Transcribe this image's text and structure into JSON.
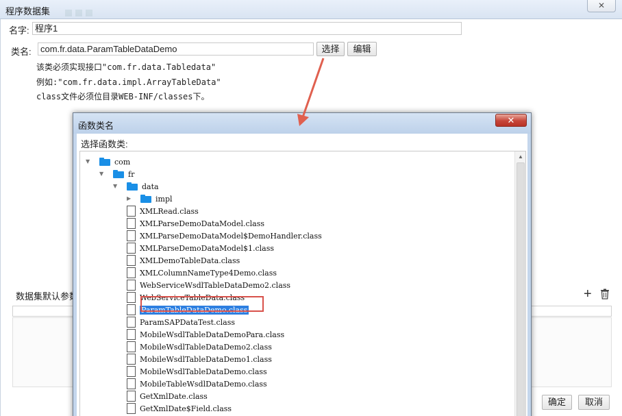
{
  "outer_dialog": {
    "title": "程序数据集",
    "close_glyph": "✕",
    "name_label": "名字:",
    "name_value": "程序1",
    "class_label": "类名:",
    "class_value": "com.fr.data.ParamTableDataDemo",
    "select_button": "选择",
    "edit_button": "编辑",
    "notes": [
      "该类必须实现接口\"com.fr.data.Tabledata\"",
      "例如:\"com.fr.data.impl.ArrayTableData\"",
      "class文件必须位目录WEB-INF/classes下。"
    ],
    "params_label": "数据集默认参数",
    "add_glyph": "+",
    "ok_button": "确定",
    "cancel_button": "取消"
  },
  "inner_dialog": {
    "title": "函数类名",
    "close_glyph": "✕",
    "prompt": "选择函数类:",
    "tree": [
      {
        "label": "com",
        "type": "folder",
        "expanded": true,
        "level": 0
      },
      {
        "label": "fr",
        "type": "folder",
        "expanded": true,
        "level": 1
      },
      {
        "label": "data",
        "type": "folder",
        "expanded": true,
        "level": 2
      },
      {
        "label": "impl",
        "type": "folder",
        "expanded": false,
        "level": 3
      },
      {
        "label": "XMLRead.class",
        "type": "file",
        "level": 3
      },
      {
        "label": "XMLParseDemoDataModel.class",
        "type": "file",
        "level": 3
      },
      {
        "label": "XMLParseDemoDataModel$DemoHandler.class",
        "type": "file",
        "level": 3
      },
      {
        "label": "XMLParseDemoDataModel$1.class",
        "type": "file",
        "level": 3
      },
      {
        "label": "XMLDemoTableData.class",
        "type": "file",
        "level": 3
      },
      {
        "label": "XMLColumnNameType4Demo.class",
        "type": "file",
        "level": 3
      },
      {
        "label": "WebServiceWsdlTableDataDemo2.class",
        "type": "file",
        "level": 3
      },
      {
        "label": "WebServiceTableData.class",
        "type": "file",
        "level": 3
      },
      {
        "label": "ParamTableDataDemo.class",
        "type": "file",
        "level": 3,
        "selected": true
      },
      {
        "label": "ParamSAPDataTest.class",
        "type": "file",
        "level": 3
      },
      {
        "label": "MobileWsdlTableDataDemoPara.class",
        "type": "file",
        "level": 3
      },
      {
        "label": "MobileWsdlTableDataDemo2.class",
        "type": "file",
        "level": 3
      },
      {
        "label": "MobileWsdlTableDataDemo1.class",
        "type": "file",
        "level": 3
      },
      {
        "label": "MobileWsdlTableDataDemo.class",
        "type": "file",
        "level": 3
      },
      {
        "label": "MobileTableWsdlDataDemo.class",
        "type": "file",
        "level": 3
      },
      {
        "label": "GetXmlDate.class",
        "type": "file",
        "level": 3
      },
      {
        "label": "GetXmlDate$Field.class",
        "type": "file",
        "level": 3
      }
    ]
  },
  "colors": {
    "selection": "#2e7fe0",
    "highlight_box": "#d8514a",
    "annotation_arrow": "#e0604f",
    "folder": "#1a8fe6"
  }
}
